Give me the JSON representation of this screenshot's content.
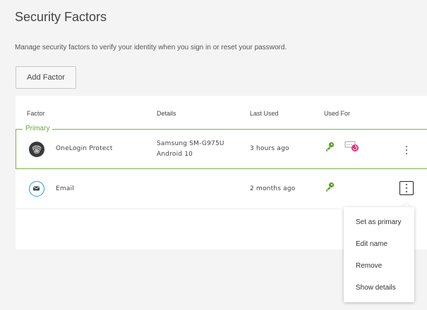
{
  "page": {
    "title": "Security Factors",
    "subtitle": "Manage security factors to verify your identity when you sign in or reset your password."
  },
  "toolbar": {
    "add_factor_label": "Add Factor"
  },
  "table": {
    "columns": [
      "Factor",
      "Details",
      "Last Used",
      "Used For"
    ],
    "primary_legend": "Primary",
    "rows": [
      {
        "factor": "OneLogin Protect",
        "factor_icon": "fingerprint-icon",
        "details_line1": "Samsung SM-G975U",
        "details_line2": "Android 10",
        "last_used": "3 hours ago",
        "used_for": [
          "key-icon",
          "password-reset-icon"
        ],
        "is_primary": true
      },
      {
        "factor": "Email",
        "factor_icon": "envelope-icon",
        "details_line1": "",
        "details_line2": "",
        "last_used": "2 months ago",
        "used_for": [
          "key-icon"
        ],
        "is_primary": false
      }
    ]
  },
  "row_menu": {
    "items": [
      "Set as primary",
      "Edit name",
      "Remove",
      "Show details"
    ]
  },
  "colors": {
    "primary_border": "#7cb342",
    "key_green": "#5aa02c",
    "reset_pink": "#e5307a",
    "email_blue": "#2196f3"
  }
}
